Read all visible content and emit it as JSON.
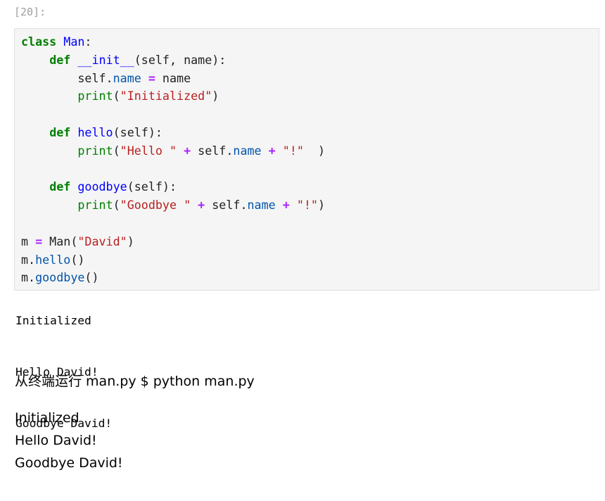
{
  "cell": {
    "prompt": "[20]:"
  },
  "code": {
    "lines": [
      [
        {
          "t": "class",
          "c": "kw"
        },
        {
          "t": " "
        },
        {
          "t": "Man",
          "c": "fn"
        },
        {
          "t": ":"
        }
      ],
      [
        {
          "t": "    "
        },
        {
          "t": "def",
          "c": "kw"
        },
        {
          "t": " "
        },
        {
          "t": "__init__",
          "c": "fn"
        },
        {
          "t": "(self, name):"
        }
      ],
      [
        {
          "t": "        self."
        },
        {
          "t": "name",
          "c": "attr"
        },
        {
          "t": " "
        },
        {
          "t": "=",
          "c": "op"
        },
        {
          "t": " name"
        }
      ],
      [
        {
          "t": "        "
        },
        {
          "t": "print",
          "c": "bi"
        },
        {
          "t": "("
        },
        {
          "t": "\"Initialized\"",
          "c": "str"
        },
        {
          "t": ")"
        }
      ],
      [
        {
          "t": ""
        }
      ],
      [
        {
          "t": "    "
        },
        {
          "t": "def",
          "c": "kw"
        },
        {
          "t": " "
        },
        {
          "t": "hello",
          "c": "fn"
        },
        {
          "t": "(self):"
        }
      ],
      [
        {
          "t": "        "
        },
        {
          "t": "print",
          "c": "bi"
        },
        {
          "t": "("
        },
        {
          "t": "\"Hello \"",
          "c": "str"
        },
        {
          "t": " "
        },
        {
          "t": "+",
          "c": "op"
        },
        {
          "t": " self."
        },
        {
          "t": "name",
          "c": "attr"
        },
        {
          "t": " "
        },
        {
          "t": "+",
          "c": "op"
        },
        {
          "t": " "
        },
        {
          "t": "\"!\"",
          "c": "str"
        },
        {
          "t": "  )"
        }
      ],
      [
        {
          "t": ""
        }
      ],
      [
        {
          "t": "    "
        },
        {
          "t": "def",
          "c": "kw"
        },
        {
          "t": " "
        },
        {
          "t": "goodbye",
          "c": "fn"
        },
        {
          "t": "(self):"
        }
      ],
      [
        {
          "t": "        "
        },
        {
          "t": "print",
          "c": "bi"
        },
        {
          "t": "("
        },
        {
          "t": "\"Goodbye \"",
          "c": "str"
        },
        {
          "t": " "
        },
        {
          "t": "+",
          "c": "op"
        },
        {
          "t": " self."
        },
        {
          "t": "name",
          "c": "attr"
        },
        {
          "t": " "
        },
        {
          "t": "+",
          "c": "op"
        },
        {
          "t": " "
        },
        {
          "t": "\"!\"",
          "c": "str"
        },
        {
          "t": ")"
        }
      ],
      [
        {
          "t": ""
        }
      ],
      [
        {
          "t": "m "
        },
        {
          "t": "=",
          "c": "op"
        },
        {
          "t": " Man("
        },
        {
          "t": "\"David\"",
          "c": "str"
        },
        {
          "t": ")"
        }
      ],
      [
        {
          "t": "m."
        },
        {
          "t": "hello",
          "c": "attr"
        },
        {
          "t": "()"
        }
      ],
      [
        {
          "t": "m."
        },
        {
          "t": "goodbye",
          "c": "attr"
        },
        {
          "t": "()"
        }
      ]
    ]
  },
  "output": {
    "lines": [
      "Initialized",
      "Hello David!",
      "Goodbye David!"
    ]
  },
  "markdown": {
    "text": "从终端运行 man.py $ python man.py",
    "output_lines": [
      "Initialized",
      "Hello David!",
      "Goodbye David!"
    ]
  },
  "colors": {
    "keyword": "#008000",
    "function_name": "#0000ff",
    "attribute": "#0055aa",
    "operator": "#aa22ff",
    "string": "#ba2121",
    "cell_background": "#f5f5f5",
    "prompt": "#9e9e9e"
  }
}
